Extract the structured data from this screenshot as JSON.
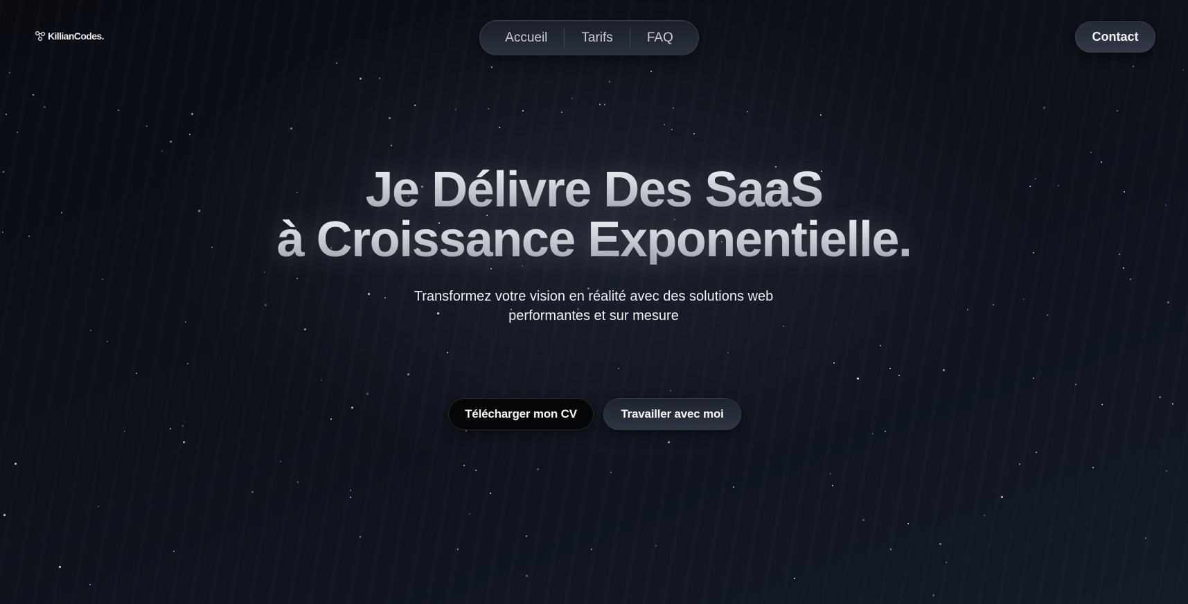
{
  "brand": {
    "name": "KillianCodes.",
    "icon": "nodes-logo-icon"
  },
  "nav": {
    "items": [
      {
        "label": "Accueil"
      },
      {
        "label": "Tarifs"
      },
      {
        "label": "FAQ"
      }
    ]
  },
  "header": {
    "contact_label": "Contact"
  },
  "hero": {
    "title_line1": "Je Délivre Des SaaS",
    "title_line2": "à Croissance Exponentielle.",
    "subtitle": "Transformez votre vision en réalité avec des solutions web performantes et sur mesure",
    "cta_download_cv": "Télécharger mon CV",
    "cta_work_with_me": "Travailler avec moi"
  },
  "colors": {
    "background": "#0a0d14",
    "text": "#ffffff",
    "nav_text": "#c9ccd3",
    "button_dark": "#050608",
    "button_slate": "#2e3442"
  }
}
